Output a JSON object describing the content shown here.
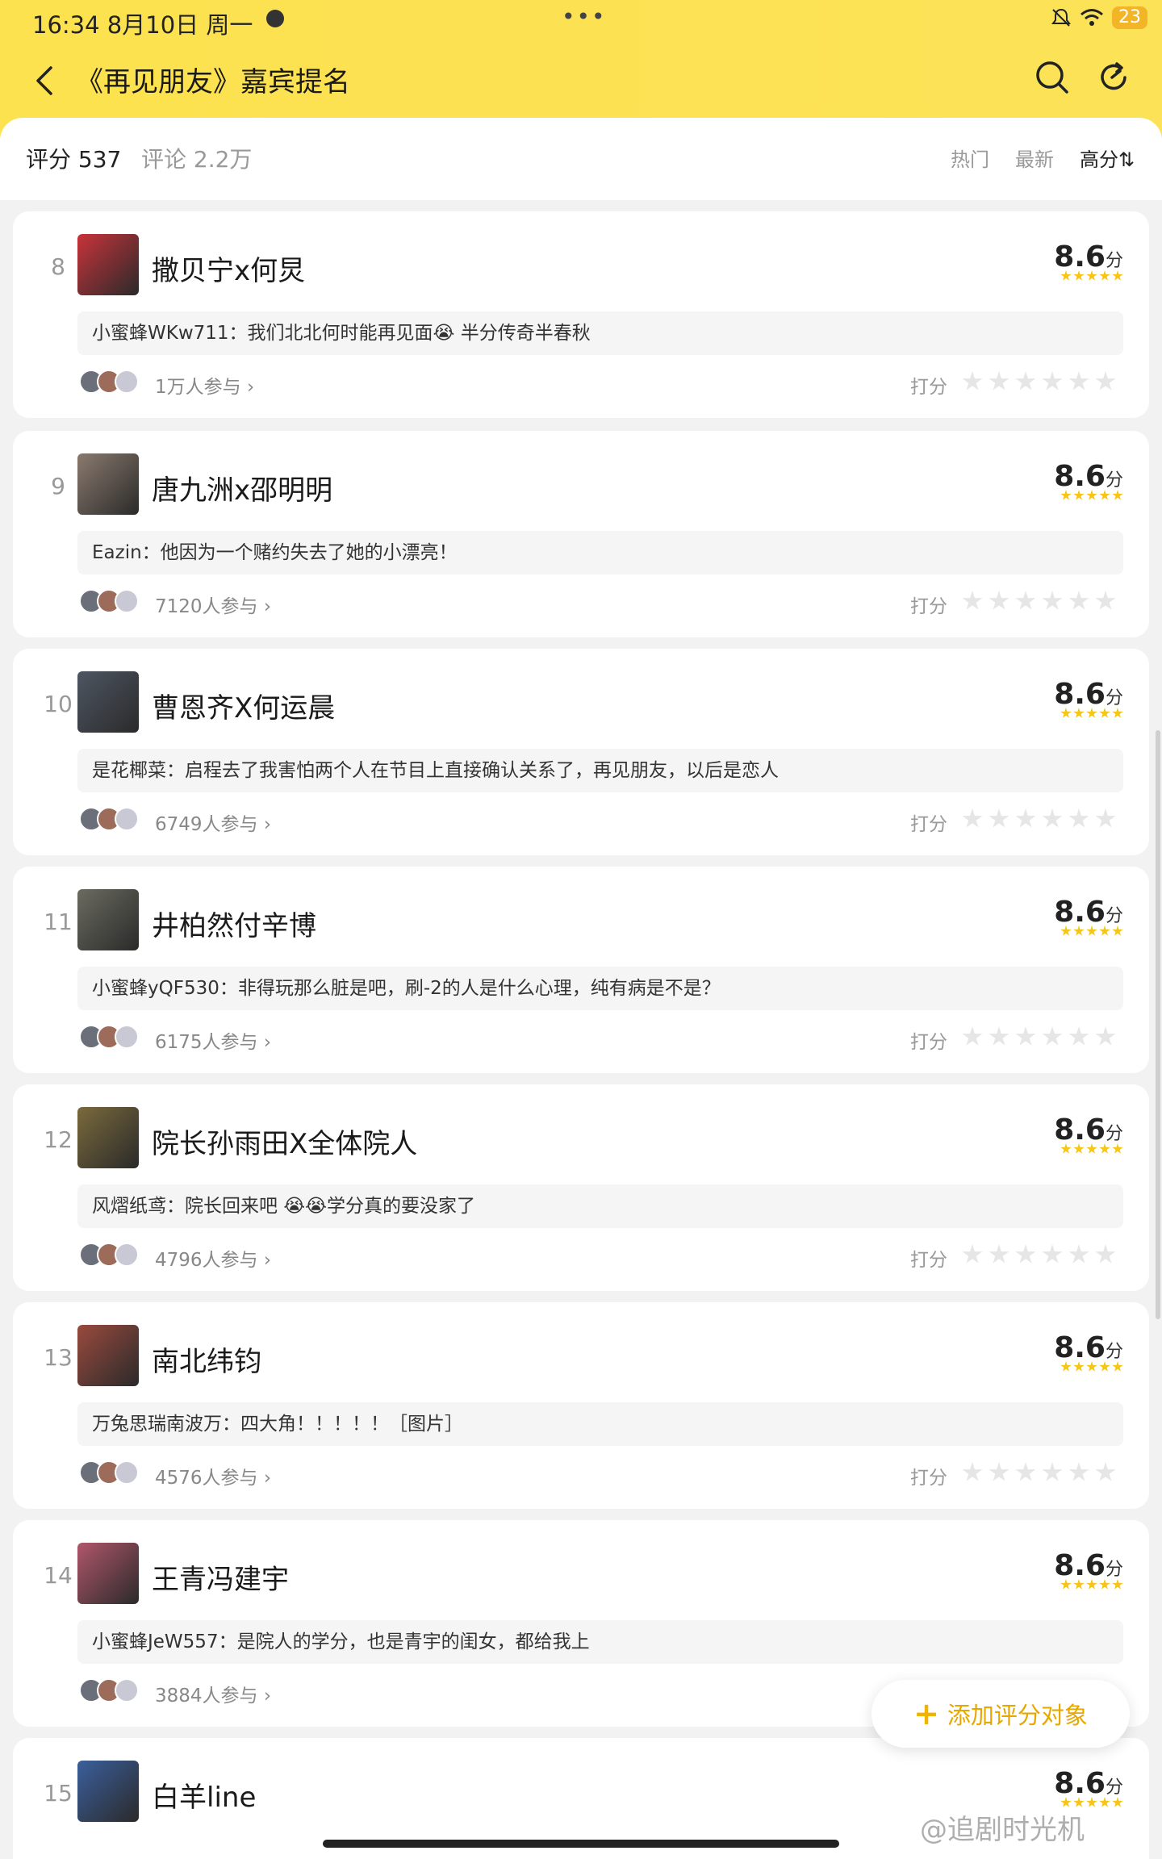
{
  "status": {
    "time": "16:34",
    "date": "8月10日 周一",
    "more": "•••",
    "battery": "23"
  },
  "nav": {
    "title": "《再见朋友》嘉宾提名"
  },
  "summary": {
    "score_label": "评分 537",
    "comment_label": "评论 2.2万",
    "sort_hot": "热门",
    "sort_new": "最新",
    "sort_high": "高分⇅"
  },
  "cards": [
    {
      "rank": "8",
      "name": "撒贝宁x何炅",
      "score": "8.6",
      "unit": "分",
      "comment": "小蜜蜂WKw711：我们北北何时能再见面😭 半分传奇半春秋",
      "participants": "1万人参与 ›",
      "rate_label": "打分",
      "thumb_color": "#c8333a"
    },
    {
      "rank": "9",
      "name": "唐九洲x邵明明",
      "score": "8.6",
      "unit": "分",
      "comment": "Eazin：他因为一个赌约失去了她的小漂亮！",
      "participants": "7120人参与 ›",
      "rate_label": "打分",
      "thumb_color": "#8a7a6e"
    },
    {
      "rank": "10",
      "name": "曹恩齐X何运晨",
      "score": "8.6",
      "unit": "分",
      "comment": "是花椰菜：启程去了我害怕两个人在节目上直接确认关系了，再见朋友，以后是恋人",
      "participants": "6749人参与 ›",
      "rate_label": "打分",
      "thumb_color": "#4e5663"
    },
    {
      "rank": "11",
      "name": "井柏然付辛博",
      "score": "8.6",
      "unit": "分",
      "comment": "小蜜蜂yQF530：非得玩那么脏是吧，刷-2的人是什么心理，纯有病是不是？",
      "participants": "6175人参与 ›",
      "rate_label": "打分",
      "thumb_color": "#6b6b60"
    },
    {
      "rank": "12",
      "name": "院长孙雨田X全体院人",
      "score": "8.6",
      "unit": "分",
      "comment": "风熠纸鸢：院长回来吧 😭😭学分真的要没家了",
      "participants": "4796人参与 ›",
      "rate_label": "打分",
      "thumb_color": "#7a6a3c"
    },
    {
      "rank": "13",
      "name": "南北纬钧",
      "score": "8.6",
      "unit": "分",
      "comment": "万兔思瑞南波万：四大角！！！！！［图片］",
      "participants": "4576人参与 ›",
      "rate_label": "打分",
      "thumb_color": "#9a4a3e"
    },
    {
      "rank": "14",
      "name": "王青冯建宇",
      "score": "8.6",
      "unit": "分",
      "comment": "小蜜蜂JeW557：是院人的学分，也是青宇的闺女，都给我上",
      "participants": "3884人参与 ›",
      "rate_label": "打分",
      "thumb_color": "#b0566a"
    },
    {
      "rank": "15",
      "name": "白羊line",
      "score": "8.6",
      "unit": "分",
      "comment": "",
      "participants": "",
      "rate_label": "",
      "thumb_color": "#3b5f9c"
    }
  ],
  "add_button": {
    "label": "添加评分对象"
  },
  "watermark": "@追剧时光机"
}
